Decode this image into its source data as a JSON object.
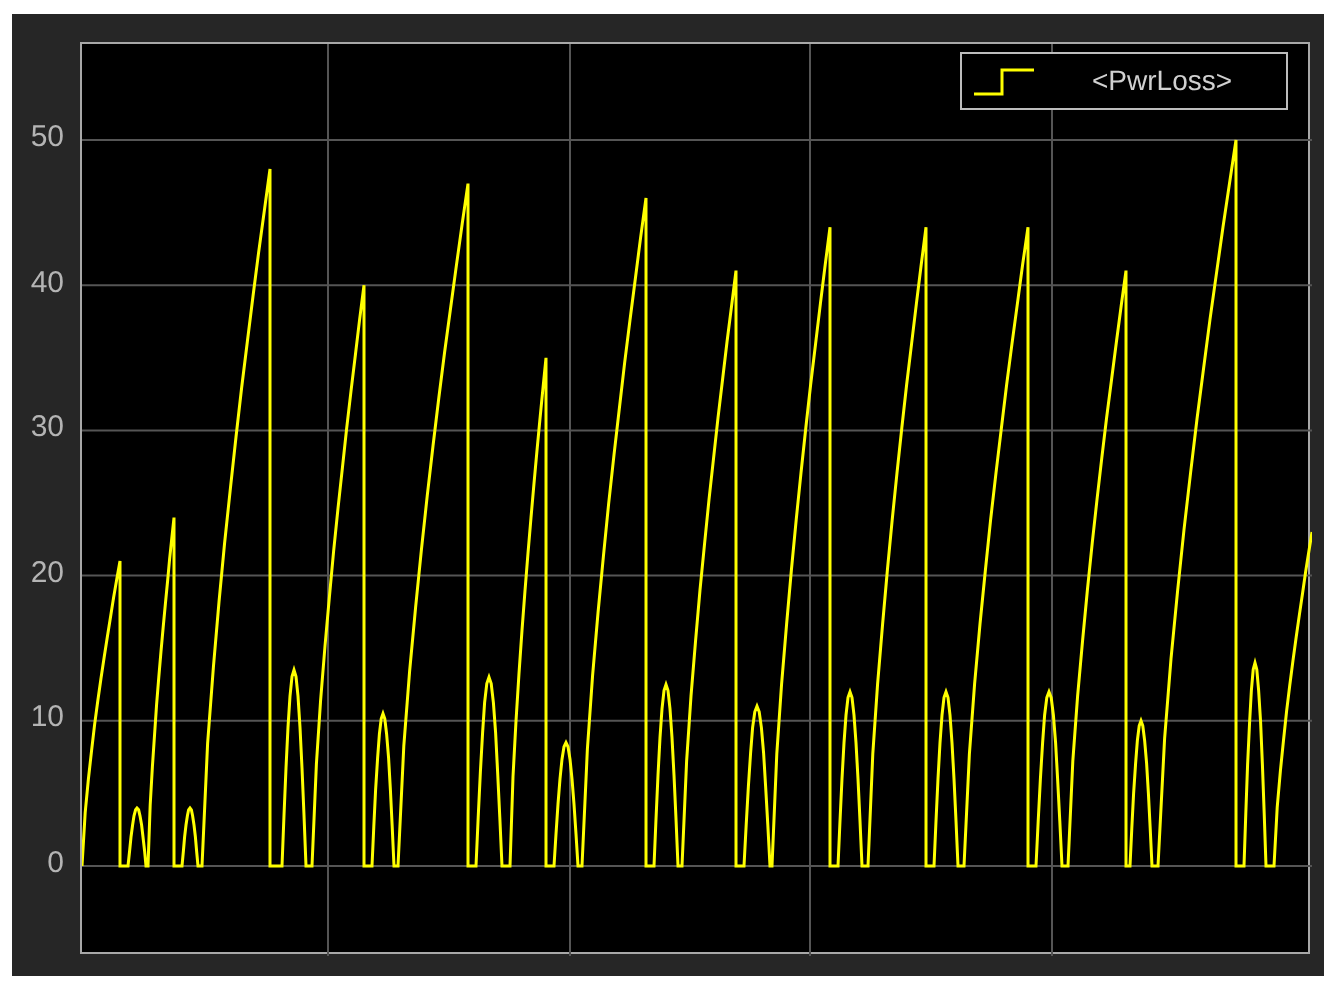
{
  "plot": {
    "y_tick_labels": [
      "50",
      "40",
      "30",
      "20",
      "10",
      "0"
    ],
    "legend": {
      "label": "<PwrLoss>"
    }
  }
}
